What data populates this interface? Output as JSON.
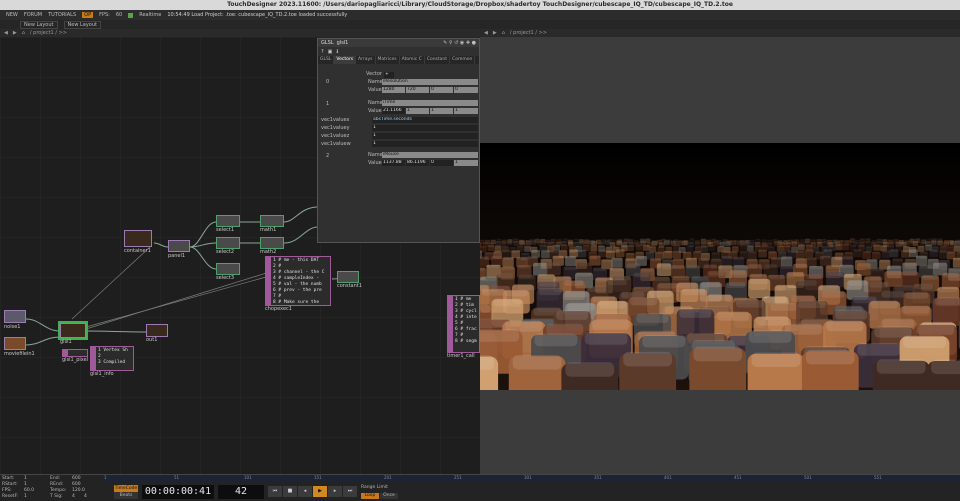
{
  "window": {
    "title": "TouchDesigner 2023.11600: /Users/dariopagliaricci/Library/CloudStorage/Dropbox/shadertoy TouchDesigner/cubescape_IQ_TD/cubescape_IQ_TD.2.toe"
  },
  "menubar": {
    "items": [
      "NEW",
      "FORUM",
      "TUTORIALS"
    ],
    "badge": "OP",
    "fps_label": "FPS:",
    "fps_value": "60",
    "realtime_label": "Realtime",
    "status": "10:54:49 Load Project: .toe: cubescape_IQ_TD.2.toe loaded successfully"
  },
  "layoutbar": {
    "new_layout": "New Layout",
    "new_layout_2": "New Layout"
  },
  "pane_left": {
    "path": "/ project1 / >>"
  },
  "pane_right": {
    "path": "/ project1 / >>"
  },
  "nodes": {
    "container1": "container1",
    "panel1": "panel1",
    "select1": "select1",
    "select2": "select2",
    "select3": "select3",
    "math1": "math1",
    "math2": "math2",
    "chopexec1": "chopexec1",
    "constant1": "constant1",
    "noise1": "noise1",
    "moviefilein1": "moviefilein1",
    "glsl1": "glsl1",
    "glsl1_pixel": "glsl1_pixel",
    "glsl1_info": "glsl1_info",
    "out1": "out1",
    "timer1_call": "timer1_call",
    "glsl1_info_text": "1 Vertex Sh\n2\n3 Compiled",
    "chopexec_text": "1 # me - this DAT\n2 #\n3 # channel - the C\n4 # sampleIndex -\n5 # val - the numb\n6 # prev - the pre\n7 #\n8 # Make sure the",
    "timer_text": "1 # me\n2 # tim\n3 # cycl\n4 # inte\n5 #\n6 # frac\n7 #\n8 # segm"
  },
  "param": {
    "op_type": "GLSL",
    "op_name": "glsl1",
    "tabs": [
      "GLSL",
      "Vectors",
      "Arrays",
      "Matrices",
      "Atomic C",
      "Constant",
      "Common"
    ],
    "active_tab": "Vectors",
    "vector_label": "Vector",
    "v0": {
      "index": "0",
      "name_label": "Name",
      "name": "iResolution",
      "value_label": "Value",
      "values": [
        "1280",
        "720",
        "0",
        "0"
      ]
    },
    "v1": {
      "index": "1",
      "name_label": "Name",
      "name": "iTime",
      "value_label": "Value",
      "values": [
        "21.1166",
        "1",
        "1",
        "1"
      ]
    },
    "vec1value": {
      "label": "vec1valuex",
      "expr": "absTime.seconds"
    },
    "extra_rows": [
      {
        "label": "vec1valuey",
        "value": "1"
      },
      {
        "label": "vec1valuez",
        "value": "1"
      },
      {
        "label": "vec1valuew",
        "value": "1"
      }
    ],
    "v2": {
      "index": "2",
      "name_label": "Name",
      "name": "iMouse",
      "value_label": "Value",
      "values": [
        "1137.88",
        "86.1196",
        "0",
        "1"
      ]
    }
  },
  "timeline": {
    "start_label": "Start:",
    "start": "1",
    "end_label": "End:",
    "end": "600",
    "rstart_label": "RStart:",
    "rstart": "1",
    "rend_label": "REnd:",
    "rend": "600",
    "fps_label": "FPS:",
    "fps": "60.0",
    "tempo_label": "Tempo:",
    "tempo": "120.0",
    "reset_label": "ResetF:",
    "reset": "1",
    "tsig_label": "T Sig:",
    "tsig": "4",
    "tsig2": "4",
    "timecode_label": "TimeCode",
    "beats_label": "Beats",
    "timecode": "00:00:00:41",
    "frame": "42",
    "range_limit_label": "Range Limit",
    "loop_label": "Loop",
    "once_label": "Once",
    "ruler_ticks": [
      "1",
      "51",
      "101",
      "151",
      "201",
      "251",
      "301",
      "351",
      "401",
      "451",
      "501",
      "551"
    ]
  }
}
